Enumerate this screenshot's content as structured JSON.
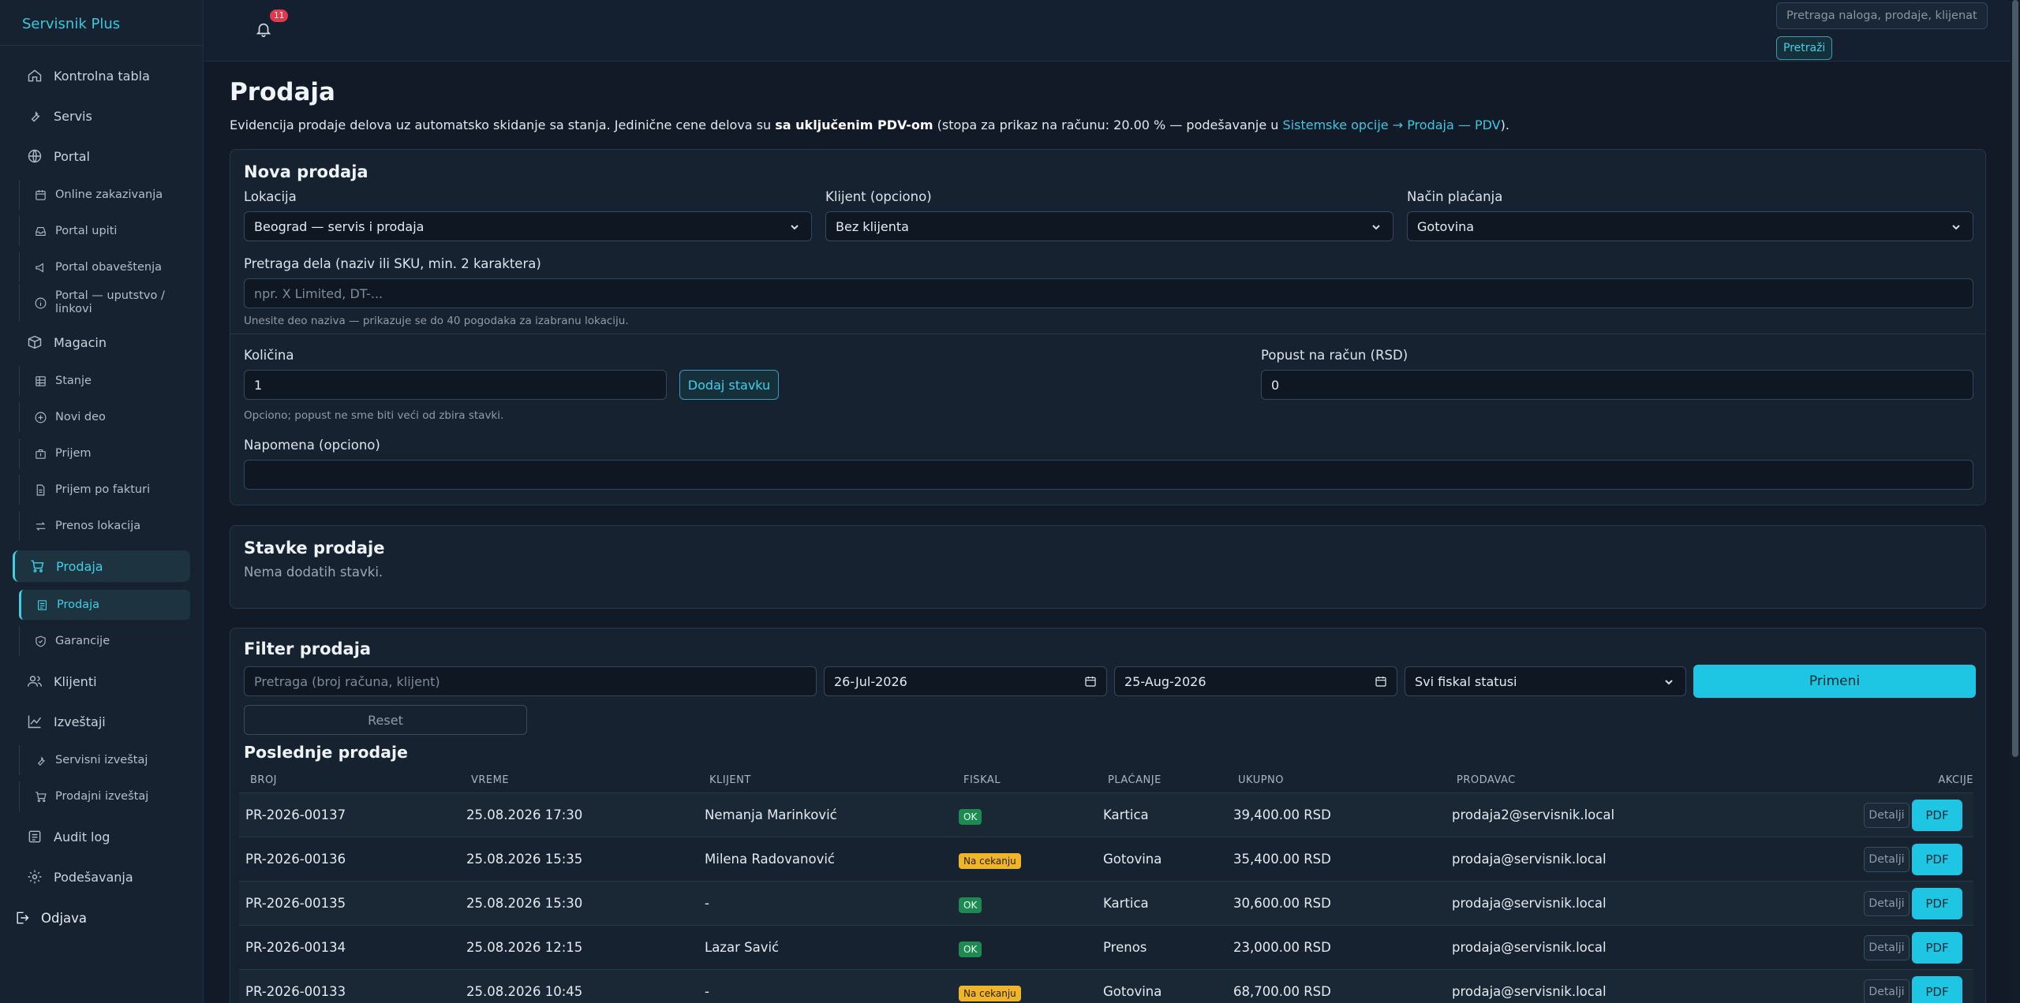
{
  "app": {
    "brand": "Servisnik Plus"
  },
  "topbar": {
    "notification_count": "11",
    "search_placeholder": "Pretraga naloga, prodaje, klijenata...",
    "search_button": "Pretraži"
  },
  "sidebar": {
    "items": [
      {
        "label": "Kontrolna tabla",
        "icon": "home-icon"
      },
      {
        "label": "Servis",
        "icon": "wrench-icon"
      },
      {
        "label": "Portal",
        "icon": "globe-icon"
      },
      {
        "label": "Online zakazivanja",
        "icon": "calendar-icon"
      },
      {
        "label": "Portal upiti",
        "icon": "inbox-icon"
      },
      {
        "label": "Portal obaveštenja",
        "icon": "megaphone-icon"
      },
      {
        "label": "Portal — uputstvo / linkovi",
        "icon": "info-icon"
      },
      {
        "label": "Magacin",
        "icon": "box-icon"
      },
      {
        "label": "Stanje",
        "icon": "table-icon"
      },
      {
        "label": "Novi deo",
        "icon": "plus-circle-icon"
      },
      {
        "label": "Prijem",
        "icon": "package-icon"
      },
      {
        "label": "Prijem po fakturi",
        "icon": "file-icon"
      },
      {
        "label": "Prenos lokacija",
        "icon": "transfer-icon"
      },
      {
        "label": "Prodaja",
        "icon": "cart-icon"
      },
      {
        "label": "Prodaja",
        "icon": "receipt-icon"
      },
      {
        "label": "Garancije",
        "icon": "shield-icon"
      },
      {
        "label": "Klijenti",
        "icon": "users-icon"
      },
      {
        "label": "Izveštaji",
        "icon": "chart-icon"
      },
      {
        "label": "Servisni izveštaj",
        "icon": "wrench-icon"
      },
      {
        "label": "Prodajni izveštaj",
        "icon": "cart-icon"
      },
      {
        "label": "Audit log",
        "icon": "log-icon"
      },
      {
        "label": "Podešavanja",
        "icon": "gear-icon"
      },
      {
        "label": "Odjava",
        "icon": "logout-icon"
      }
    ]
  },
  "page": {
    "title": "Prodaja",
    "intro_1": "Evidencija prodaje delova uz automatsko skidanje sa stanja. Jedinične cene delova su ",
    "intro_bold": "sa uključenim PDV-om",
    "intro_2": " (stopa za prikaz na računu: 20.00 % — podešavanje u ",
    "intro_link": "Sistemske opcije → Prodaja — PDV",
    "intro_3": ")."
  },
  "new_sale": {
    "title": "Nova prodaja",
    "location_label": "Lokacija",
    "location_value": "Beograd — servis i prodaja",
    "client_label": "Klijent (opciono)",
    "client_value": "Bez klijenta",
    "payment_label": "Način plaćanja",
    "payment_value": "Gotovina",
    "part_search_label": "Pretraga dela (naziv ili SKU, min. 2 karaktera)",
    "part_search_placeholder": "npr. X Limited, DT-...",
    "part_search_hint": "Unesite deo naziva — prikazuje se do 40 pogodaka za izabranu lokaciju.",
    "qty_label": "Količina",
    "qty_value": "1",
    "add_item_button": "Dodaj stavku",
    "discount_label": "Popust na račun (RSD)",
    "discount_value": "0",
    "discount_hint": "Opciono; popust ne sme biti veći od zbira stavki.",
    "note_label": "Napomena (opciono)",
    "note_value": ""
  },
  "items": {
    "title": "Stavke prodaje",
    "empty_text": "Nema dodatih stavki."
  },
  "filter": {
    "title": "Filter prodaja",
    "search_placeholder": "Pretraga (broj računa, klijent)",
    "date_from": "26-Jul-2026",
    "date_to": "25-Aug-2026",
    "fiscal_status": "Svi fiskal statusi",
    "apply_button": "Primeni",
    "reset_button": "Reset"
  },
  "recent": {
    "title": "Poslednje prodaje",
    "columns": [
      "BROJ",
      "VREME",
      "KLIJENT",
      "FISKAL",
      "PLAĆANJE",
      "UKUPNO",
      "PRODAVAC",
      "AKCIJE"
    ],
    "detail_label": "Detalji",
    "pdf_label": "PDF",
    "rows": [
      {
        "number": "PR-2026-00137",
        "time": "25.08.2026 17:30",
        "client": "Nemanja Marinković",
        "fiscal": "OK",
        "payment": "Kartica",
        "total": "39,400.00 RSD",
        "seller": "prodaja2@servisnik.local"
      },
      {
        "number": "PR-2026-00136",
        "time": "25.08.2026 15:35",
        "client": "Milena Radovanović",
        "fiscal": "Na cekanju",
        "payment": "Gotovina",
        "total": "35,400.00 RSD",
        "seller": "prodaja@servisnik.local"
      },
      {
        "number": "PR-2026-00135",
        "time": "25.08.2026 15:30",
        "client": "-",
        "fiscal": "OK",
        "payment": "Kartica",
        "total": "30,600.00 RSD",
        "seller": "prodaja@servisnik.local"
      },
      {
        "number": "PR-2026-00134",
        "time": "25.08.2026 12:15",
        "client": "Lazar Savić",
        "fiscal": "OK",
        "payment": "Prenos",
        "total": "23,000.00 RSD",
        "seller": "prodaja@servisnik.local"
      },
      {
        "number": "PR-2026-00133",
        "time": "25.08.2026 10:45",
        "client": "-",
        "fiscal": "Na cekanju",
        "payment": "Gotovina",
        "total": "68,700.00 RSD",
        "seller": "prodaja@servisnik.local"
      }
    ]
  }
}
